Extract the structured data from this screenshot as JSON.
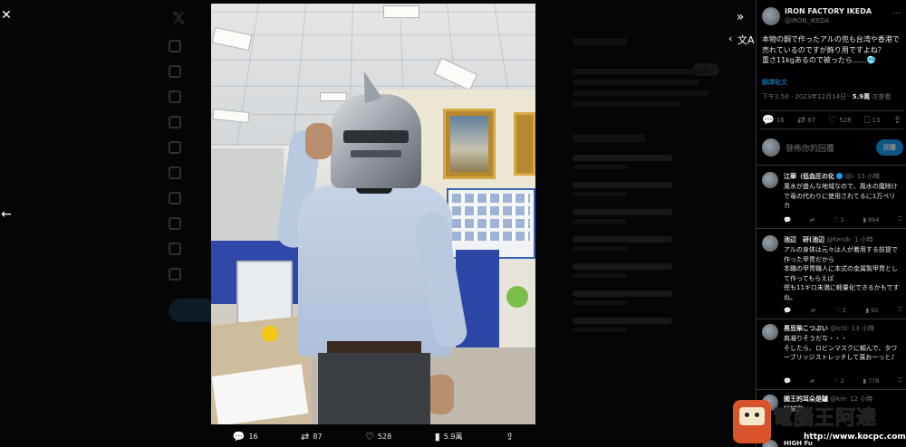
{
  "viewer": {
    "close_icon": "close-icon",
    "back_icon": "arrow-left-icon",
    "collapse_icon": "chevrons-right-icon",
    "prev_icon": "chevron-left-icon",
    "translate_icon": "translate-icon",
    "actions": {
      "replies": "16",
      "retweets": "87",
      "likes": "528",
      "views": "5.9萬"
    }
  },
  "tweet": {
    "author_name": "IRON FACTORY IKEDA",
    "author_handle": "@IRON_IKEDA",
    "text": "本物の鋼で作ったアルの兜も台湾や香港で売れているのですが飾り用ですよね？\n重さ11kgあるので被ったら……🥶",
    "translate_label": "翻譯貼文",
    "time": "下午2:50 · 2023年12月14日 ·",
    "views_count": "5.9萬",
    "views_label": "次查看",
    "stats": {
      "replies": "16",
      "retweets": "87",
      "likes": "528",
      "bookmarks": "13"
    },
    "reply_placeholder": "發佈你的回覆",
    "reply_button": "回覆"
  },
  "replies": [
    {
      "name": "江華（低血圧の化",
      "handle": "@i·",
      "time": "13 小時",
      "text": "風水が盛んな地域なので、風水の魔除けで竜の代わりに使用されてるに1万ペリカ",
      "likes": "2",
      "views": "894"
    },
    {
      "name": "池辺　研(池辺",
      "handle": "@KenIk·",
      "time": "1 小時",
      "text": "アルの身体は元々は人が着用する前提で作った甲冑だから\n本職の甲冑職人に本式の金属製甲冑として作ってもらえば\n兜も11キロ未満に軽量化できるかもですね。",
      "likes": "2",
      "views": "92"
    },
    {
      "name": "黒豆柴こつぶい",
      "handle": "@ichi·",
      "time": "13 小時",
      "text": "肩凝りそうだな・・・\nそしたら、ロビンマスクに頼んで、タワーブリッジストレッチして貰おーっと♪",
      "likes": "2",
      "views": "778"
    },
    {
      "name": "國王的耳朵是驢",
      "handle": "@kin·",
      "time": "12 小時",
      "text": "好誠實"
    },
    {
      "name": "HIGH Fu"
    }
  ],
  "watermark": {
    "brand": "電腦王阿達",
    "url": "http://www.kocpc.com.tw"
  },
  "colors": {
    "accent": "#1d9bf0",
    "background": "#000000",
    "muted": "#71767b"
  }
}
